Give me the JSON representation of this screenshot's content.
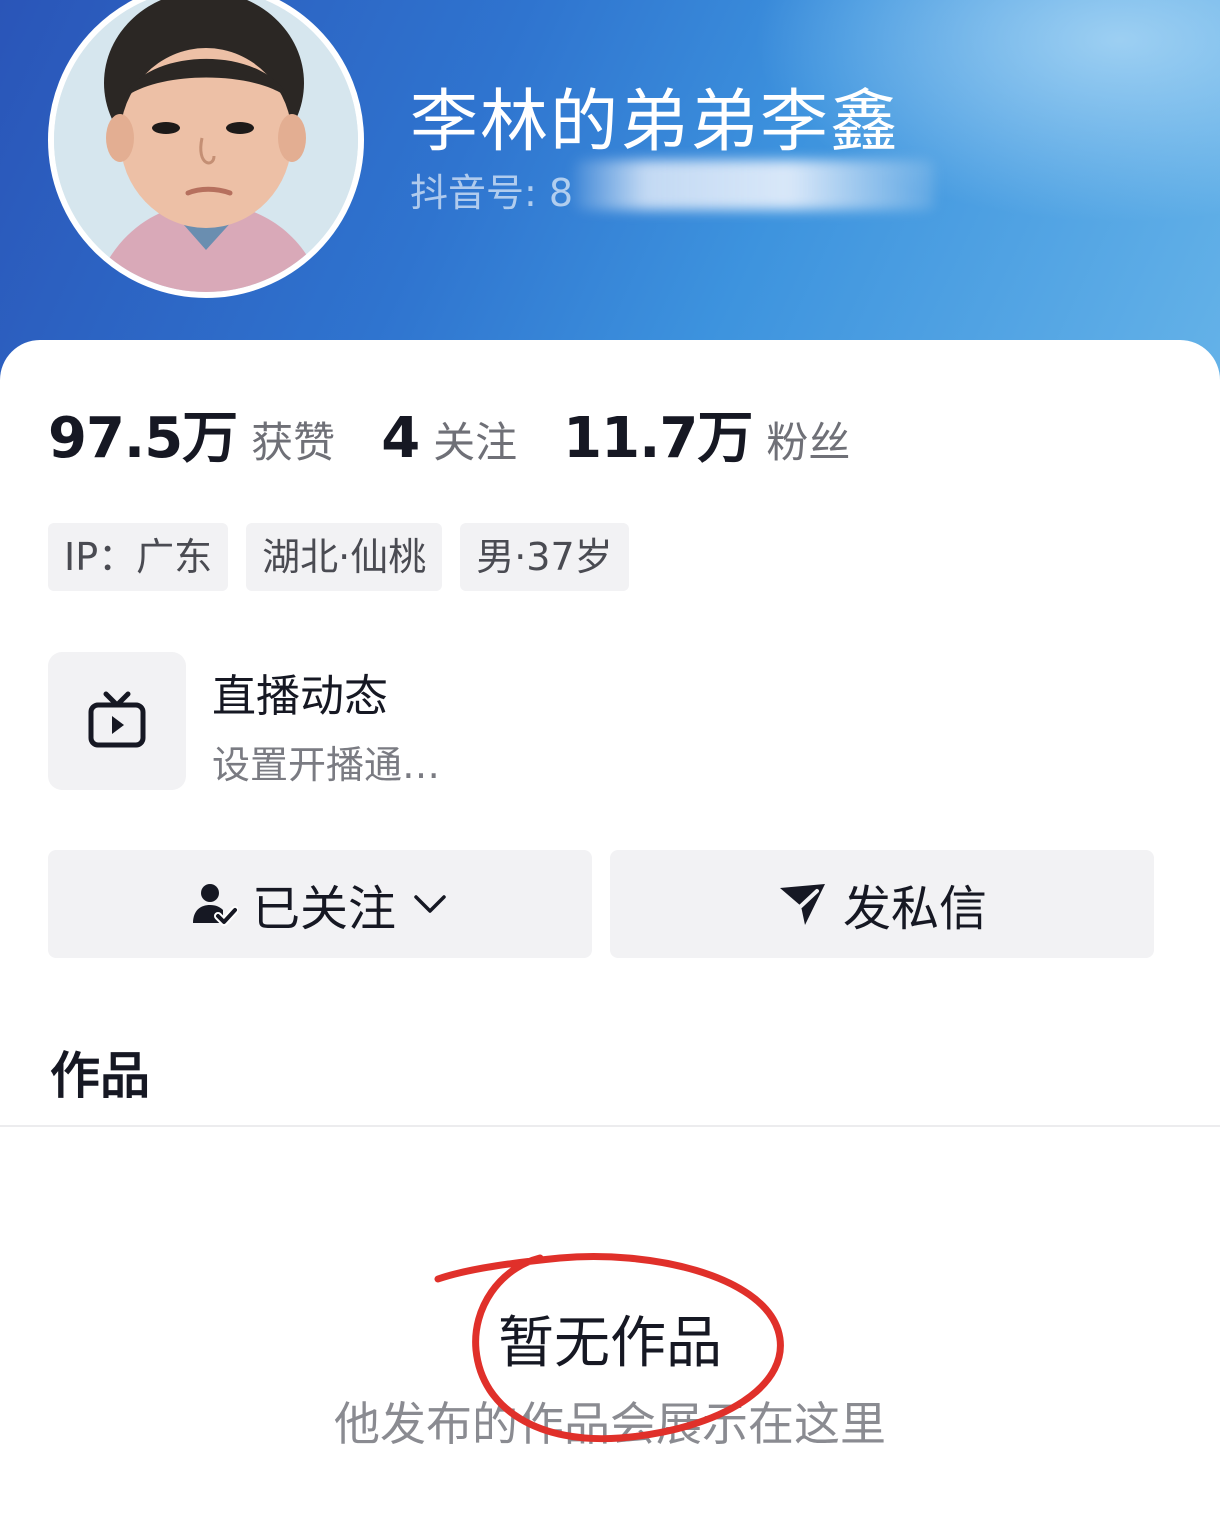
{
  "profile": {
    "name": "李林的弟弟李鑫",
    "id_label": "抖音号: 8",
    "stats": [
      {
        "value": "97.5万",
        "label": "获赞"
      },
      {
        "value": "4",
        "label": "关注"
      },
      {
        "value": "11.7万",
        "label": "粉丝"
      }
    ],
    "tags": [
      "IP：广东",
      "湖北·仙桃",
      "男·37岁"
    ]
  },
  "live": {
    "title": "直播动态",
    "subtitle": "设置开播通…",
    "icon": "tv-icon"
  },
  "actions": {
    "follow_label": "已关注",
    "follow_icon": "user-check-icon",
    "message_label": "发私信",
    "message_icon": "send-icon"
  },
  "tabs": {
    "works": "作品"
  },
  "empty_state": {
    "title": "暂无作品",
    "subtitle": "他发布的作品会展示在这里"
  },
  "colors": {
    "header_blue": "#2f74cf",
    "annotation_red": "#e0302a"
  }
}
